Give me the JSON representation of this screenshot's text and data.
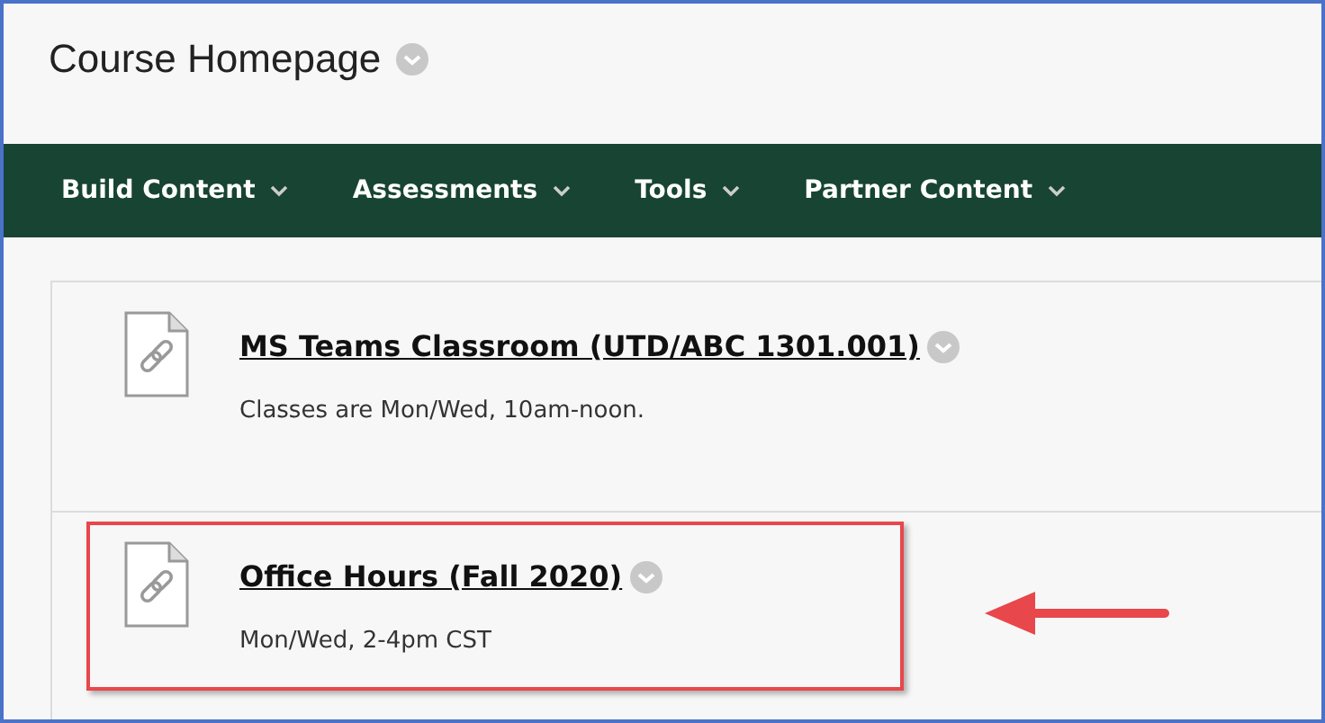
{
  "page": {
    "title": "Course Homepage"
  },
  "menu": [
    {
      "label": "Build Content"
    },
    {
      "label": "Assessments"
    },
    {
      "label": "Tools"
    },
    {
      "label": "Partner Content"
    }
  ],
  "items": [
    {
      "title": "MS Teams Classroom (UTD/ABC 1301.001)",
      "description": "Classes are Mon/Wed, 10am-noon.",
      "highlighted": false
    },
    {
      "title": "Office Hours (Fall 2020)",
      "description": "Mon/Wed, 2-4pm CST",
      "highlighted": true
    }
  ]
}
